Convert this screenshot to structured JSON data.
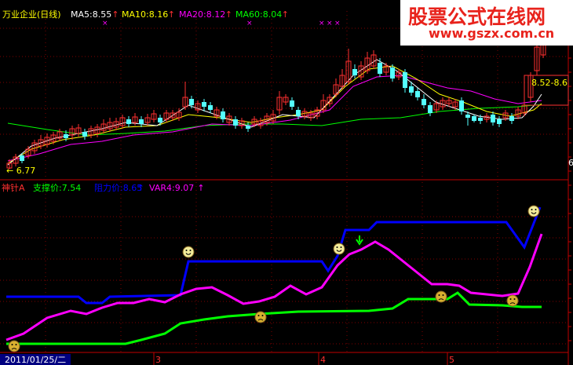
{
  "top_panel": {
    "title": "万业企业(日线)",
    "indicators": [
      {
        "label": "MA5:8.55",
        "color": "#ffffff"
      },
      {
        "label": "MA10:8.16",
        "color": "#ffff00"
      },
      {
        "label": "MA20:8.12",
        "color": "#ff00ff"
      },
      {
        "label": "MA60:8.04",
        "color": "#00ff00"
      }
    ],
    "low_marker": "← 6.77",
    "high_marker": "8.52-8.6",
    "edge_label": "6"
  },
  "bottom_panel": {
    "indicator_name": "神针A",
    "support": "支撑价:7.54",
    "resistance": "阻力价:8.65",
    "var4": "VAR4:9.07"
  },
  "x_axis": {
    "start_date": "2011/01/25/二",
    "months": [
      "3",
      "4",
      "5"
    ]
  },
  "watermark": {
    "line1": "股票公式在线网",
    "line2": "www.gszx.com.cn"
  },
  "colors": {
    "up_candle": "#ff3030",
    "down_candle": "#54ffff",
    "support_line": "#00ff00",
    "resistance_line": "#0000ff",
    "var4_line": "#ff00ff",
    "grid": "#800000",
    "smile": "#f0e060"
  }
}
